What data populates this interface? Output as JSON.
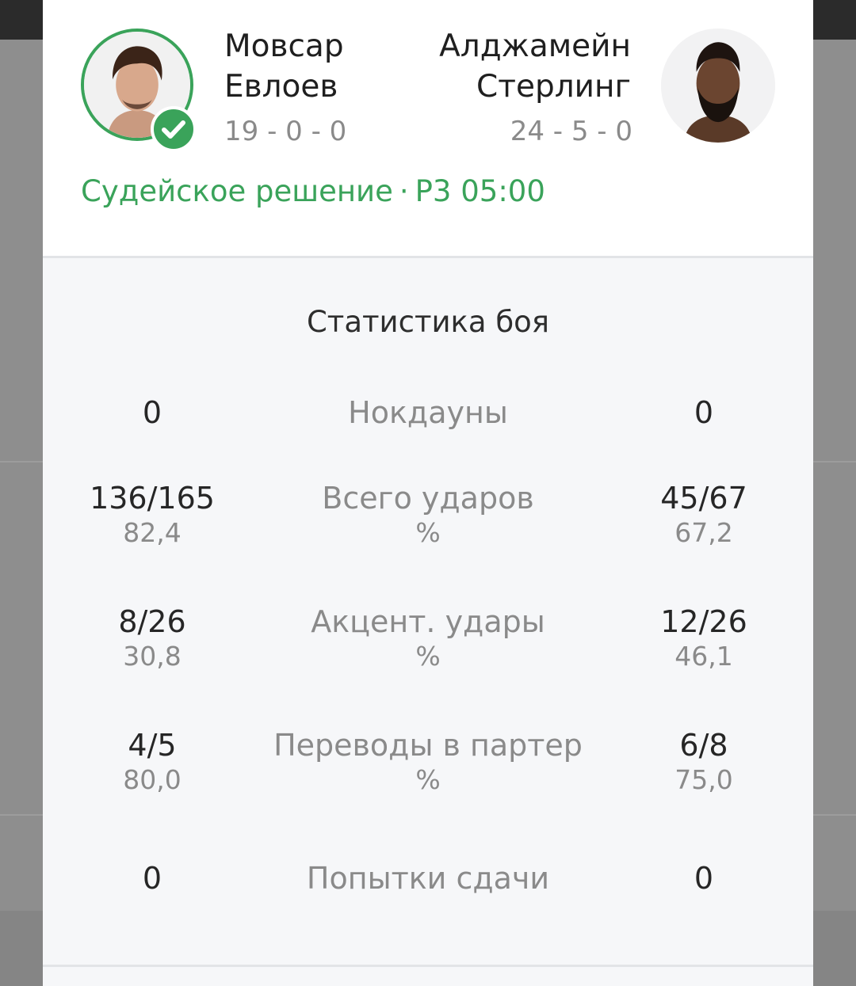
{
  "header": {
    "left_fighter": {
      "first_name": "Мовсар",
      "last_name": "Евлоев",
      "record": "19 - 0 - 0",
      "winner": true
    },
    "right_fighter": {
      "first_name": "Алджамейн",
      "last_name": "Стерлинг",
      "record": "24 - 5 - 0",
      "winner": false
    },
    "result": {
      "method": "Судейское решение",
      "separator": "·",
      "time": "Р3 05:00"
    }
  },
  "stats": {
    "title": "Статистика боя",
    "rows": [
      {
        "label": "Нокдауны",
        "left": "0",
        "right": "0"
      },
      {
        "label": "Всего ударов",
        "sub": "%",
        "left": "136/165",
        "left_pct": "82,4",
        "right": "45/67",
        "right_pct": "67,2"
      },
      {
        "label": "Акцент. удары",
        "sub": "%",
        "left": "8/26",
        "left_pct": "30,8",
        "right": "12/26",
        "right_pct": "46,1"
      },
      {
        "label": "Переводы в партер",
        "sub": "%",
        "left": "4/5",
        "left_pct": "80,0",
        "right": "6/8",
        "right_pct": "75,0"
      },
      {
        "label": "Попытки сдачи",
        "left": "0",
        "right": "0"
      }
    ]
  },
  "colors": {
    "winner_green": "#3aa35a",
    "stats_background": "#f6f7f9"
  },
  "icons": {
    "winner_badge": "checkmark-icon"
  }
}
